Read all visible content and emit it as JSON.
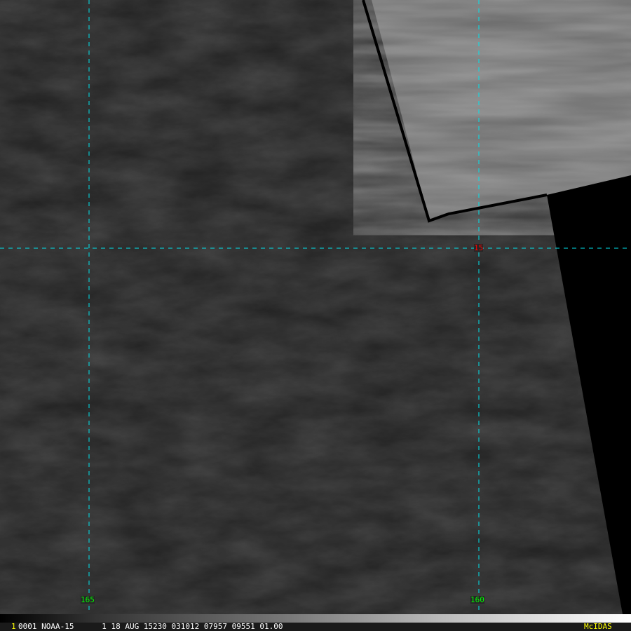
{
  "colors": {
    "grid": "#00e5ee",
    "lon_label": "#00ff00",
    "lat_label": "#ff0000",
    "brand": "#ffff00"
  },
  "grid": {
    "longitudes": [
      "165",
      "160"
    ],
    "latitudes": [
      "15"
    ]
  },
  "infobar": {
    "frame": "1",
    "text": "0001 NOAA-15      1 18 AUG 15230 031012 07957 09551 01.00",
    "brand": "McIDAS"
  }
}
